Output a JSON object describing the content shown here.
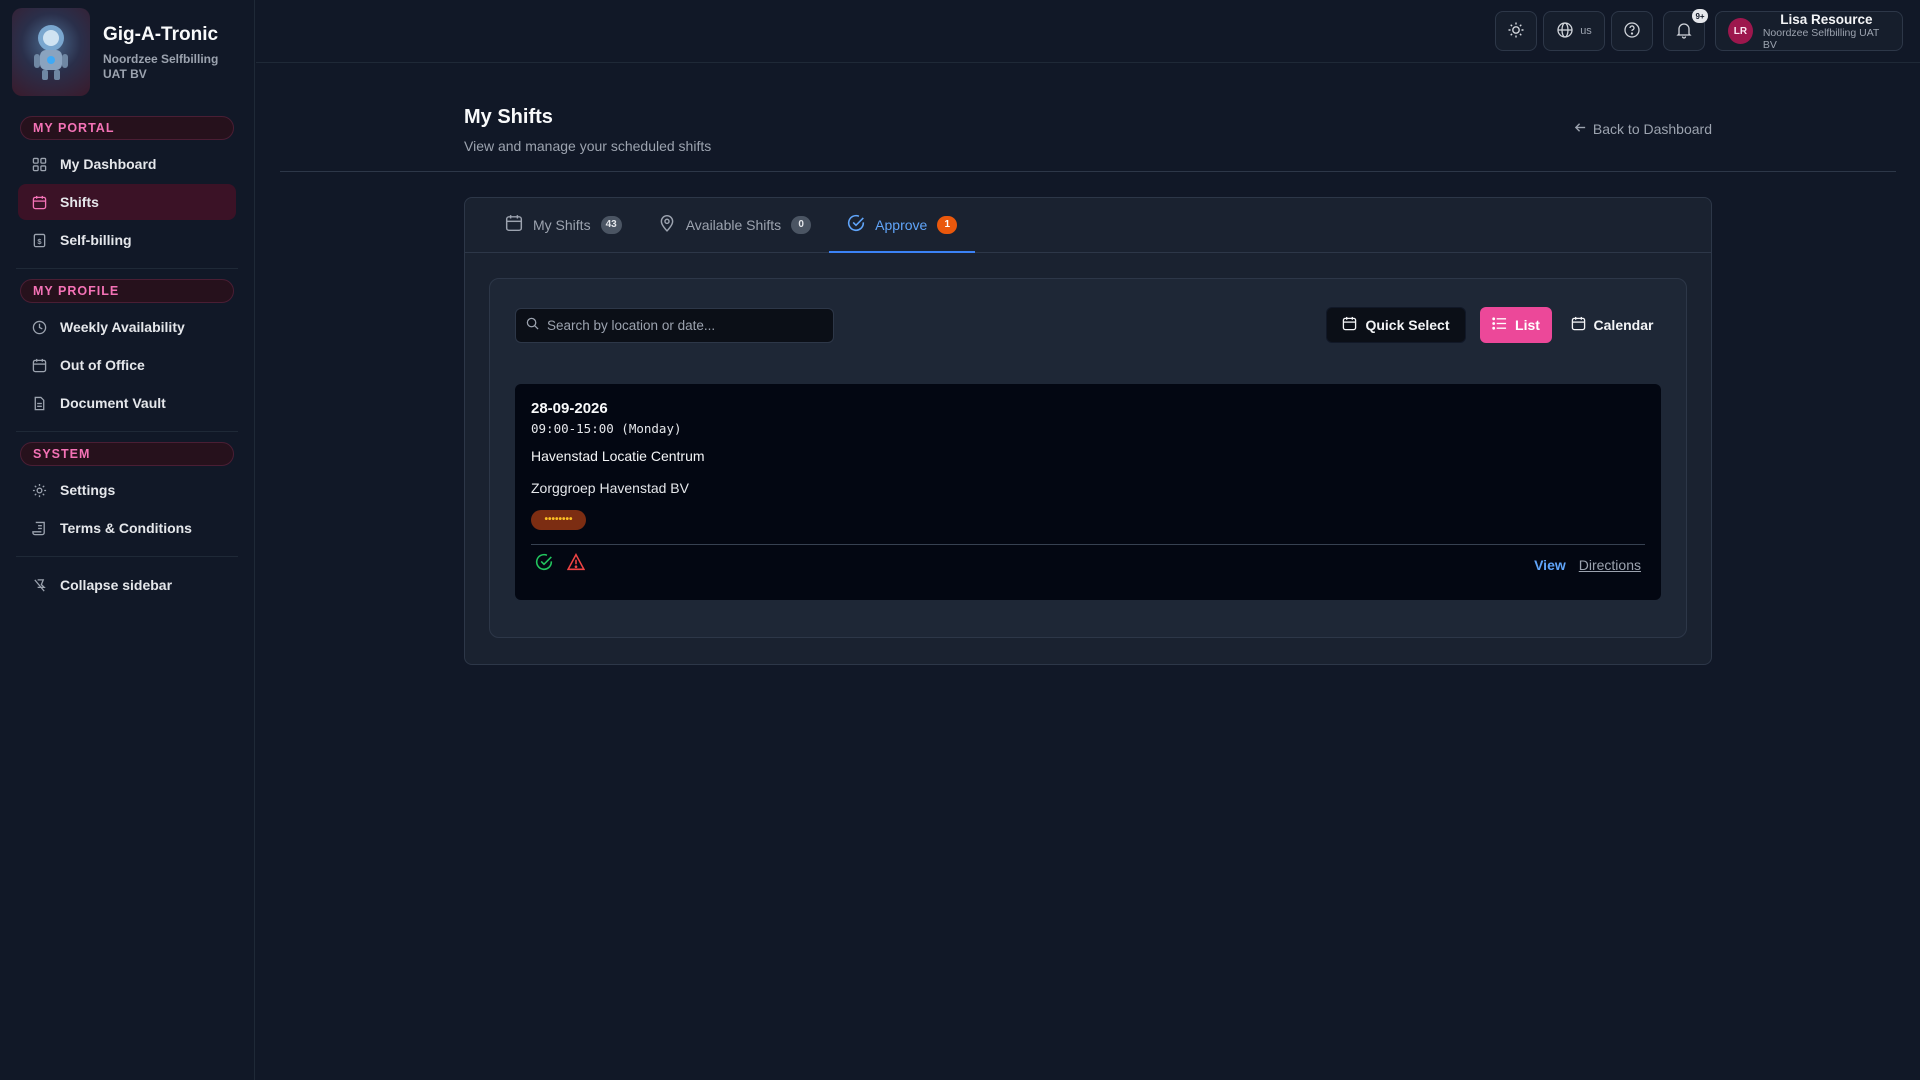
{
  "app": {
    "name": "Gig-A-Tronic",
    "org": "Noordzee Selfbilling UAT BV"
  },
  "sidebar": {
    "sections": [
      {
        "title": "MY PORTAL",
        "items": [
          {
            "label": "My Dashboard",
            "icon": "grid-icon"
          },
          {
            "label": "Shifts",
            "icon": "calendar-icon",
            "active": true
          },
          {
            "label": "Self-billing",
            "icon": "invoice-icon"
          }
        ]
      },
      {
        "title": "MY PROFILE",
        "items": [
          {
            "label": "Weekly Availability",
            "icon": "clock-icon"
          },
          {
            "label": "Out of Office",
            "icon": "calendar-icon"
          },
          {
            "label": "Document Vault",
            "icon": "document-icon"
          }
        ]
      },
      {
        "title": "SYSTEM",
        "items": [
          {
            "label": "Settings",
            "icon": "gear-icon"
          },
          {
            "label": "Terms & Conditions",
            "icon": "scroll-icon"
          }
        ]
      }
    ],
    "collapse_label": "Collapse sidebar"
  },
  "topbar": {
    "language": "us",
    "notifications_badge": "9+",
    "user": {
      "initials": "LR",
      "name": "Lisa Resource",
      "org": "Noordzee Selfbilling UAT BV"
    }
  },
  "page": {
    "title": "My Shifts",
    "subtitle": "View and manage your scheduled shifts",
    "back_label": "Back to Dashboard"
  },
  "tabs": [
    {
      "label": "My Shifts",
      "count": "43",
      "icon": "calendar-icon"
    },
    {
      "label": "Available Shifts",
      "count": "0",
      "icon": "map-pin-icon"
    },
    {
      "label": "Approve",
      "count": "1",
      "icon": "check-circle-icon",
      "active": true
    }
  ],
  "toolbar": {
    "search_placeholder": "Search by location or date...",
    "quick_select_label": "Quick Select",
    "list_label": "List",
    "calendar_label": "Calendar"
  },
  "shift": {
    "date": "28-09-2026",
    "time": "09:00-15:00 (Monday)",
    "location": "Havenstad Locatie Centrum",
    "client": "Zorggroep Havenstad BV",
    "status_badge": "••••••••",
    "view_label": "View",
    "directions_label": "Directions"
  },
  "colors": {
    "accent_pink": "#ec4899",
    "accent_blue": "#3b82f6",
    "badge_orange": "#ea580c",
    "check_green": "#22c55e",
    "warning_red": "#ef4444"
  }
}
